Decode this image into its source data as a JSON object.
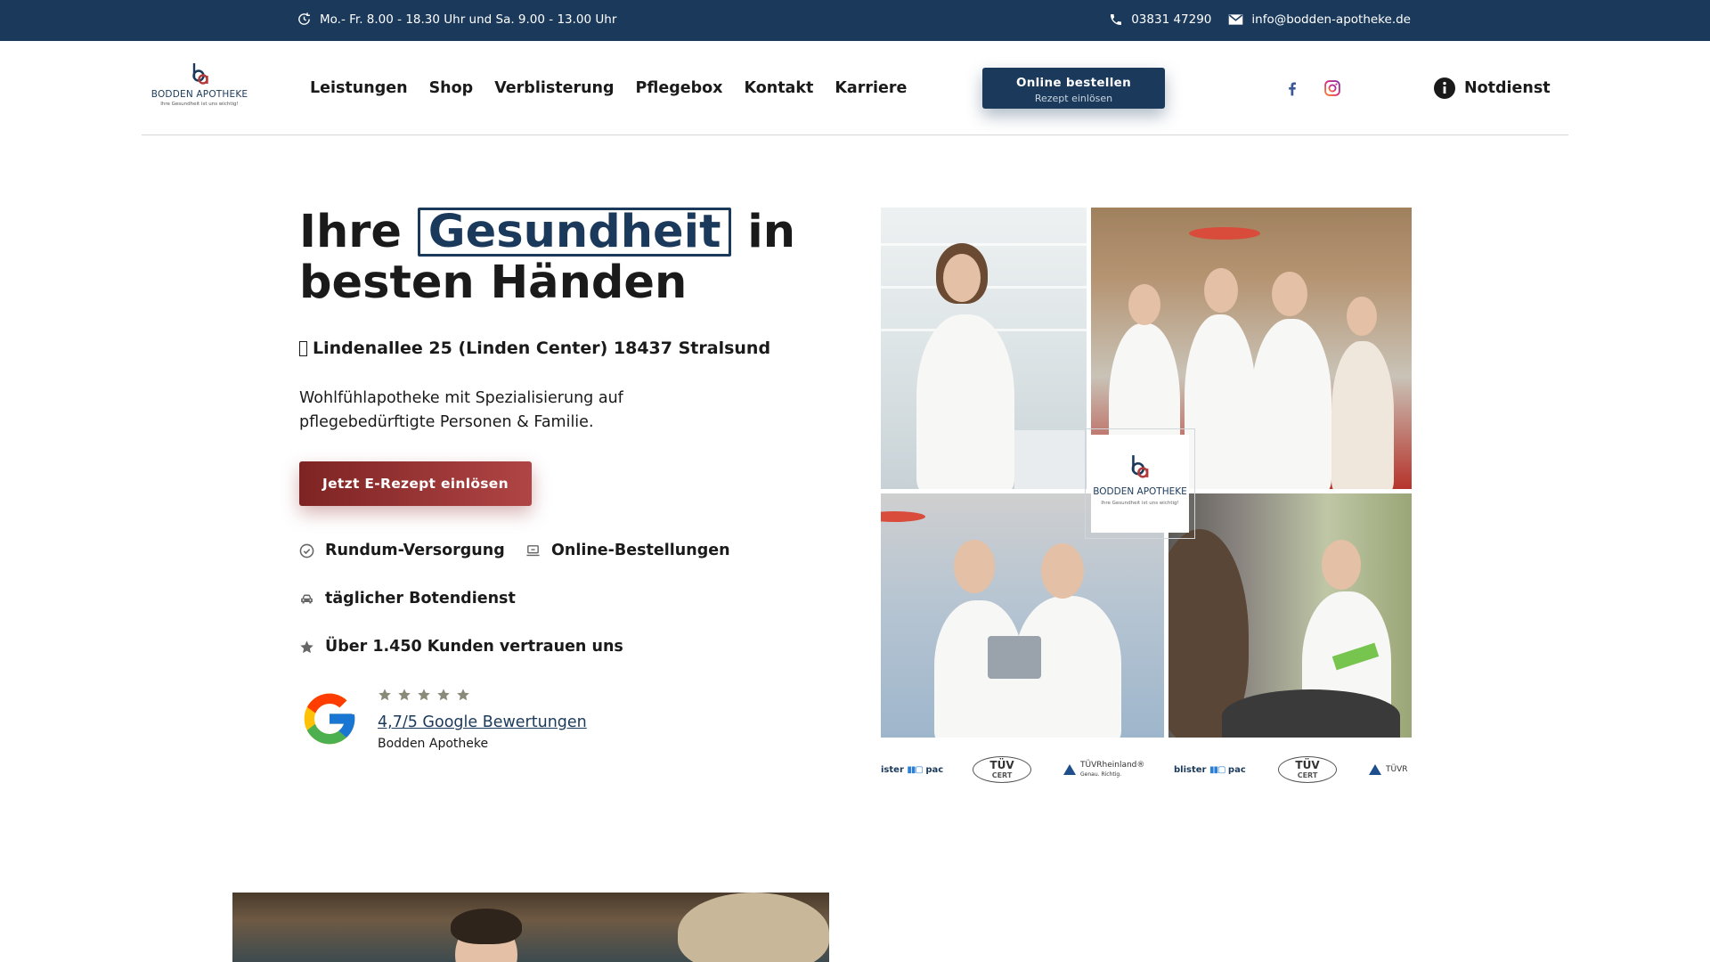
{
  "topbar": {
    "hours": "Mo.- Fr. 8.00 - 18.30 Uhr und Sa. 9.00 - 13.00 Uhr",
    "phone": "03831 47290",
    "email": "info@bodden-apotheke.de"
  },
  "logo": {
    "brand": "BODDEN APOTHEKE",
    "tagline": "Ihre Gesundheit ist uns wichtig!"
  },
  "nav": {
    "items": [
      "Leistungen",
      "Shop",
      "Verblisterung",
      "Pflegebox",
      "Kontakt",
      "Karriere"
    ]
  },
  "order_button": {
    "title": "Online bestellen",
    "subtitle": "Rezept einlösen"
  },
  "social": {
    "icons": [
      "facebook-icon",
      "instagram-icon"
    ]
  },
  "notdienst": {
    "label": "Notdienst"
  },
  "hero": {
    "title_before": "Ihre",
    "title_highlight": "Gesundheit",
    "title_after": "in besten Händen",
    "address": "Lindenallee 25 (Linden Center) 18437 Stralsund",
    "description": "Wohlfühlapotheke mit Spezialisierung auf pflegebedürftigte Personen & Familie.",
    "cta": "Jetzt E-Rezept einlösen",
    "features": [
      "Rundum-Versorgung",
      "Online-Bestellungen",
      "täglicher Botendienst",
      "Über 1.450 Kunden vertrauen uns"
    ]
  },
  "rating": {
    "stars": 5,
    "link": "4,7/5 Google Bewertungen",
    "name": "Bodden Apotheke"
  },
  "collage_logo": {
    "brand": "BODDEN APOTHEKE",
    "tagline": "Ihre Gesundheit ist uns wichtig!"
  },
  "certs": {
    "blister_pre": "ister",
    "blister": "blister",
    "pac": "pac",
    "tuv": "TÜV",
    "cert": "CERT",
    "rheinland": "TÜVRheinland®",
    "rheinland_sub": "Genau. Richtig.",
    "rheinland_short": "TÜVR"
  },
  "colors": {
    "brand_navy": "#1b3a5b",
    "cta_red": "#a33a3a",
    "star_gray": "#8a8a7a"
  }
}
